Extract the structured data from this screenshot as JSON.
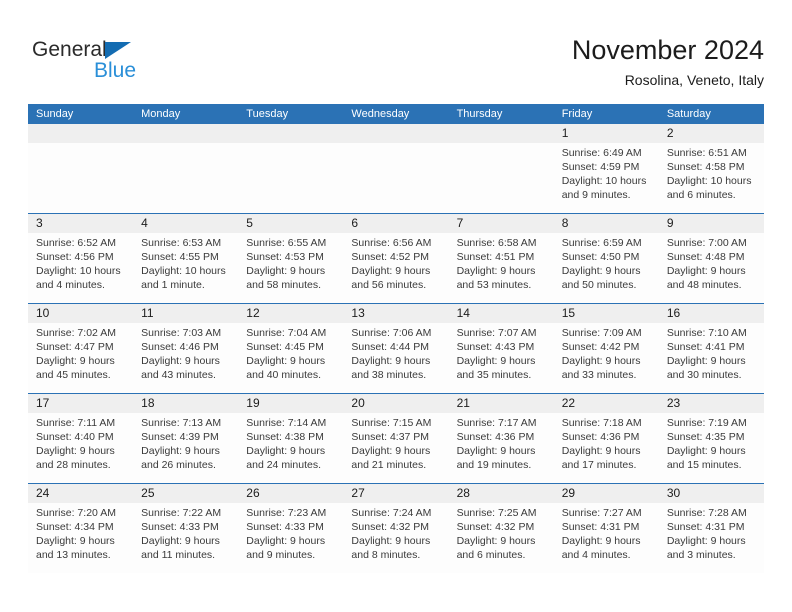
{
  "brand": {
    "name_part1": "General",
    "name_part2": "Blue"
  },
  "header": {
    "title": "November 2024",
    "subtitle": "Rosolina, Veneto, Italy"
  },
  "weekdays": [
    "Sunday",
    "Monday",
    "Tuesday",
    "Wednesday",
    "Thursday",
    "Friday",
    "Saturday"
  ],
  "colors": {
    "header_blue": "#2b72b5",
    "date_band_gray": "#efefef",
    "brand_blue": "#2a8fd8",
    "triangle_blue": "#136cb2"
  },
  "labels": {
    "sunrise_prefix": "Sunrise:",
    "sunset_prefix": "Sunset:",
    "daylight_prefix": "Daylight:"
  },
  "weeks": [
    {
      "days": [
        {
          "date": "",
          "sunrise": "",
          "sunset": "",
          "daylight_line1": "",
          "daylight_line2": ""
        },
        {
          "date": "",
          "sunrise": "",
          "sunset": "",
          "daylight_line1": "",
          "daylight_line2": ""
        },
        {
          "date": "",
          "sunrise": "",
          "sunset": "",
          "daylight_line1": "",
          "daylight_line2": ""
        },
        {
          "date": "",
          "sunrise": "",
          "sunset": "",
          "daylight_line1": "",
          "daylight_line2": ""
        },
        {
          "date": "",
          "sunrise": "",
          "sunset": "",
          "daylight_line1": "",
          "daylight_line2": ""
        },
        {
          "date": "1",
          "sunrise": "Sunrise: 6:49 AM",
          "sunset": "Sunset: 4:59 PM",
          "daylight_line1": "Daylight: 10 hours",
          "daylight_line2": "and 9 minutes."
        },
        {
          "date": "2",
          "sunrise": "Sunrise: 6:51 AM",
          "sunset": "Sunset: 4:58 PM",
          "daylight_line1": "Daylight: 10 hours",
          "daylight_line2": "and 6 minutes."
        }
      ]
    },
    {
      "days": [
        {
          "date": "3",
          "sunrise": "Sunrise: 6:52 AM",
          "sunset": "Sunset: 4:56 PM",
          "daylight_line1": "Daylight: 10 hours",
          "daylight_line2": "and 4 minutes."
        },
        {
          "date": "4",
          "sunrise": "Sunrise: 6:53 AM",
          "sunset": "Sunset: 4:55 PM",
          "daylight_line1": "Daylight: 10 hours",
          "daylight_line2": "and 1 minute."
        },
        {
          "date": "5",
          "sunrise": "Sunrise: 6:55 AM",
          "sunset": "Sunset: 4:53 PM",
          "daylight_line1": "Daylight: 9 hours",
          "daylight_line2": "and 58 minutes."
        },
        {
          "date": "6",
          "sunrise": "Sunrise: 6:56 AM",
          "sunset": "Sunset: 4:52 PM",
          "daylight_line1": "Daylight: 9 hours",
          "daylight_line2": "and 56 minutes."
        },
        {
          "date": "7",
          "sunrise": "Sunrise: 6:58 AM",
          "sunset": "Sunset: 4:51 PM",
          "daylight_line1": "Daylight: 9 hours",
          "daylight_line2": "and 53 minutes."
        },
        {
          "date": "8",
          "sunrise": "Sunrise: 6:59 AM",
          "sunset": "Sunset: 4:50 PM",
          "daylight_line1": "Daylight: 9 hours",
          "daylight_line2": "and 50 minutes."
        },
        {
          "date": "9",
          "sunrise": "Sunrise: 7:00 AM",
          "sunset": "Sunset: 4:48 PM",
          "daylight_line1": "Daylight: 9 hours",
          "daylight_line2": "and 48 minutes."
        }
      ]
    },
    {
      "days": [
        {
          "date": "10",
          "sunrise": "Sunrise: 7:02 AM",
          "sunset": "Sunset: 4:47 PM",
          "daylight_line1": "Daylight: 9 hours",
          "daylight_line2": "and 45 minutes."
        },
        {
          "date": "11",
          "sunrise": "Sunrise: 7:03 AM",
          "sunset": "Sunset: 4:46 PM",
          "daylight_line1": "Daylight: 9 hours",
          "daylight_line2": "and 43 minutes."
        },
        {
          "date": "12",
          "sunrise": "Sunrise: 7:04 AM",
          "sunset": "Sunset: 4:45 PM",
          "daylight_line1": "Daylight: 9 hours",
          "daylight_line2": "and 40 minutes."
        },
        {
          "date": "13",
          "sunrise": "Sunrise: 7:06 AM",
          "sunset": "Sunset: 4:44 PM",
          "daylight_line1": "Daylight: 9 hours",
          "daylight_line2": "and 38 minutes."
        },
        {
          "date": "14",
          "sunrise": "Sunrise: 7:07 AM",
          "sunset": "Sunset: 4:43 PM",
          "daylight_line1": "Daylight: 9 hours",
          "daylight_line2": "and 35 minutes."
        },
        {
          "date": "15",
          "sunrise": "Sunrise: 7:09 AM",
          "sunset": "Sunset: 4:42 PM",
          "daylight_line1": "Daylight: 9 hours",
          "daylight_line2": "and 33 minutes."
        },
        {
          "date": "16",
          "sunrise": "Sunrise: 7:10 AM",
          "sunset": "Sunset: 4:41 PM",
          "daylight_line1": "Daylight: 9 hours",
          "daylight_line2": "and 30 minutes."
        }
      ]
    },
    {
      "days": [
        {
          "date": "17",
          "sunrise": "Sunrise: 7:11 AM",
          "sunset": "Sunset: 4:40 PM",
          "daylight_line1": "Daylight: 9 hours",
          "daylight_line2": "and 28 minutes."
        },
        {
          "date": "18",
          "sunrise": "Sunrise: 7:13 AM",
          "sunset": "Sunset: 4:39 PM",
          "daylight_line1": "Daylight: 9 hours",
          "daylight_line2": "and 26 minutes."
        },
        {
          "date": "19",
          "sunrise": "Sunrise: 7:14 AM",
          "sunset": "Sunset: 4:38 PM",
          "daylight_line1": "Daylight: 9 hours",
          "daylight_line2": "and 24 minutes."
        },
        {
          "date": "20",
          "sunrise": "Sunrise: 7:15 AM",
          "sunset": "Sunset: 4:37 PM",
          "daylight_line1": "Daylight: 9 hours",
          "daylight_line2": "and 21 minutes."
        },
        {
          "date": "21",
          "sunrise": "Sunrise: 7:17 AM",
          "sunset": "Sunset: 4:36 PM",
          "daylight_line1": "Daylight: 9 hours",
          "daylight_line2": "and 19 minutes."
        },
        {
          "date": "22",
          "sunrise": "Sunrise: 7:18 AM",
          "sunset": "Sunset: 4:36 PM",
          "daylight_line1": "Daylight: 9 hours",
          "daylight_line2": "and 17 minutes."
        },
        {
          "date": "23",
          "sunrise": "Sunrise: 7:19 AM",
          "sunset": "Sunset: 4:35 PM",
          "daylight_line1": "Daylight: 9 hours",
          "daylight_line2": "and 15 minutes."
        }
      ]
    },
    {
      "days": [
        {
          "date": "24",
          "sunrise": "Sunrise: 7:20 AM",
          "sunset": "Sunset: 4:34 PM",
          "daylight_line1": "Daylight: 9 hours",
          "daylight_line2": "and 13 minutes."
        },
        {
          "date": "25",
          "sunrise": "Sunrise: 7:22 AM",
          "sunset": "Sunset: 4:33 PM",
          "daylight_line1": "Daylight: 9 hours",
          "daylight_line2": "and 11 minutes."
        },
        {
          "date": "26",
          "sunrise": "Sunrise: 7:23 AM",
          "sunset": "Sunset: 4:33 PM",
          "daylight_line1": "Daylight: 9 hours",
          "daylight_line2": "and 9 minutes."
        },
        {
          "date": "27",
          "sunrise": "Sunrise: 7:24 AM",
          "sunset": "Sunset: 4:32 PM",
          "daylight_line1": "Daylight: 9 hours",
          "daylight_line2": "and 8 minutes."
        },
        {
          "date": "28",
          "sunrise": "Sunrise: 7:25 AM",
          "sunset": "Sunset: 4:32 PM",
          "daylight_line1": "Daylight: 9 hours",
          "daylight_line2": "and 6 minutes."
        },
        {
          "date": "29",
          "sunrise": "Sunrise: 7:27 AM",
          "sunset": "Sunset: 4:31 PM",
          "daylight_line1": "Daylight: 9 hours",
          "daylight_line2": "and 4 minutes."
        },
        {
          "date": "30",
          "sunrise": "Sunrise: 7:28 AM",
          "sunset": "Sunset: 4:31 PM",
          "daylight_line1": "Daylight: 9 hours",
          "daylight_line2": "and 3 minutes."
        }
      ]
    }
  ]
}
